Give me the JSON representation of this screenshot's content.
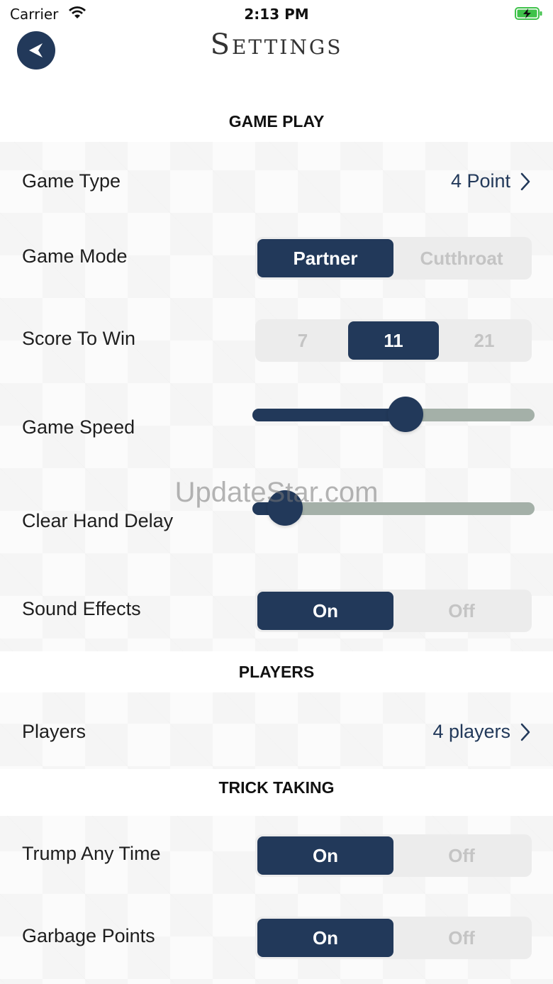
{
  "status_bar": {
    "carrier": "Carrier",
    "time": "2:13 PM"
  },
  "header": {
    "title": "Settings",
    "back_icon": "back-arrow-icon"
  },
  "sections": {
    "game_play": "GAME PLAY",
    "players": "PLAYERS",
    "trick_taking": "TRICK TAKING"
  },
  "game_type": {
    "label": "Game Type",
    "value": "4 Point"
  },
  "game_mode": {
    "label": "Game Mode",
    "options": [
      "Partner",
      "Cutthroat"
    ],
    "selected": 0
  },
  "score_to_win": {
    "label": "Score To Win",
    "options": [
      "7",
      "11",
      "21"
    ],
    "selected": 1
  },
  "game_speed": {
    "label": "Game Speed",
    "level": 0.55
  },
  "clear_hand_delay": {
    "label": "Clear Hand Delay",
    "level": 0.06
  },
  "sound_effects": {
    "label": "Sound Effects",
    "options": [
      "On",
      "Off"
    ],
    "selected": 0
  },
  "players": {
    "label": "Players",
    "value": "4 players"
  },
  "trump_any_time": {
    "label": "Trump Any Time",
    "options": [
      "On",
      "Off"
    ],
    "selected": 0
  },
  "garbage_points": {
    "label": "Garbage Points",
    "options": [
      "On",
      "Off"
    ],
    "selected": 0
  },
  "watermark": "UpdateStar.com",
  "colors": {
    "accent": "#22395a",
    "slider_track": "#a4b0a8",
    "battery": "#3fc24a"
  }
}
